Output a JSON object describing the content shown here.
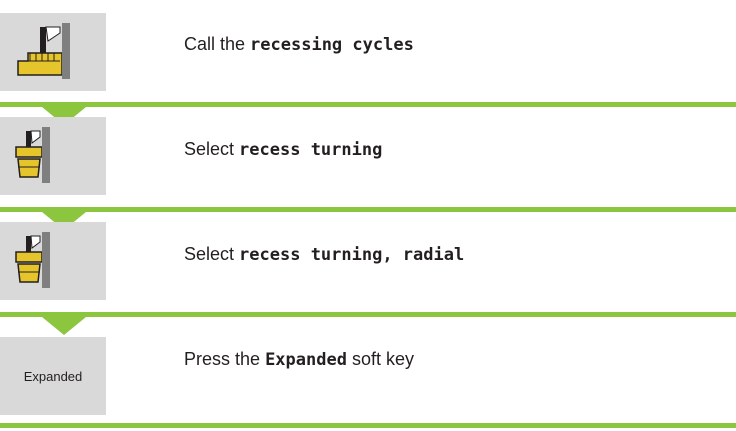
{
  "steps": [
    {
      "icon": "recessing-cycles-icon",
      "prefix": "Call the",
      "bold": "recessing cycles",
      "suffix": ""
    },
    {
      "icon": "recess-turning-icon",
      "prefix": "Select",
      "bold": "recess turning",
      "suffix": ""
    },
    {
      "icon": "recess-turning-radial-icon",
      "prefix": "Select",
      "bold": "recess turning, radial",
      "suffix": ""
    },
    {
      "key_label": "Expanded",
      "prefix": "Press the",
      "bold": "Expanded",
      "suffix": "soft key"
    }
  ],
  "colors": {
    "accent": "#8cc63f",
    "key_bg": "#d9d9d9",
    "text": "#231f20",
    "tool_yellow": "#e6c42b"
  }
}
